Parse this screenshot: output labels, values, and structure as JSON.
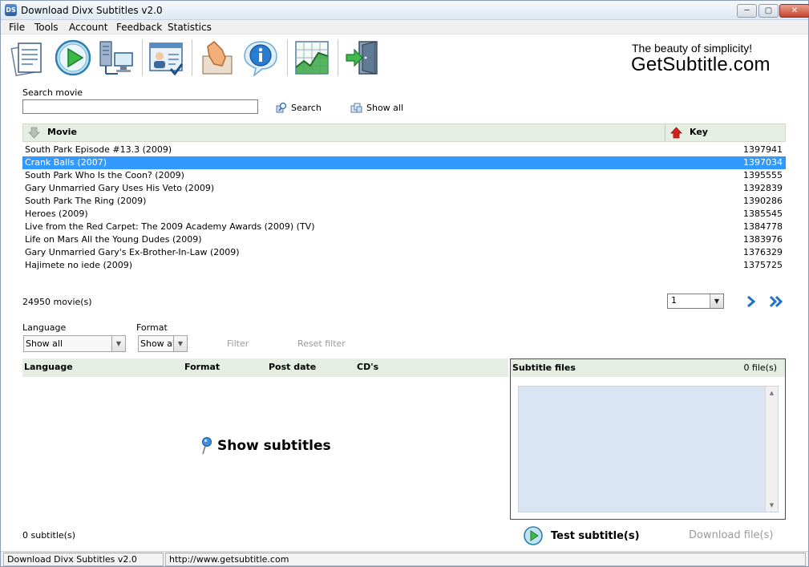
{
  "window": {
    "title": "Download Divx Subtitles v2.0",
    "app_icon_text": "DS",
    "minimize": "─",
    "maximize": "▢",
    "close": "✕"
  },
  "menu": {
    "items": [
      "File",
      "Tools",
      "Account",
      "Feedback",
      "Statistics"
    ]
  },
  "branding": {
    "tagline": "The beauty of simplicity!",
    "site": "GetSubtitle.com"
  },
  "search": {
    "label": "Search movie",
    "value": "",
    "search_label": "Search",
    "show_all_label": "Show all"
  },
  "movies": {
    "columns": {
      "movie": "Movie",
      "key": "Key"
    },
    "rows": [
      {
        "title": "South Park Episode #13.3 (2009)",
        "key": "1397941"
      },
      {
        "title": "Crank Balls (2007)",
        "key": "1397034"
      },
      {
        "title": "South Park Who Is the Coon? (2009)",
        "key": "1395555"
      },
      {
        "title": "Gary Unmarried Gary Uses His Veto (2009)",
        "key": "1392839"
      },
      {
        "title": "South Park The Ring (2009)",
        "key": "1390286"
      },
      {
        "title": "Heroes (2009)",
        "key": "1385545"
      },
      {
        "title": "Live from the Red Carpet: The 2009 Academy Awards (2009) (TV)",
        "key": "1384778"
      },
      {
        "title": "Life on Mars All the Young Dudes (2009)",
        "key": "1383976"
      },
      {
        "title": "Gary Unmarried Gary's Ex-Brother-In-Law (2009)",
        "key": "1376329"
      },
      {
        "title": "Hajimete no iede (2009)",
        "key": "1375725"
      }
    ],
    "selected_index": 1,
    "count_text": "24950 movie(s)"
  },
  "pagination": {
    "page": "1"
  },
  "filters": {
    "language_label": "Language",
    "language_value": "Show all",
    "format_label": "Format",
    "format_value": "Show all",
    "filter_label": "Filter",
    "reset_label": "Reset filter"
  },
  "subtitles": {
    "columns": {
      "language": "Language",
      "format": "Format",
      "post_date": "Post date",
      "cds": "CD's"
    },
    "show_label": "Show subtitles",
    "count_text": "0 subtitle(s)"
  },
  "files": {
    "title": "Subtitle files",
    "count": "0 file(s)"
  },
  "actions": {
    "test": "Test subtitle(s)",
    "download": "Download file(s)"
  },
  "status": {
    "app": "Download Divx Subtitles v2.0",
    "url": "http://www.getsubtitle.com"
  },
  "colors": {
    "selection": "#3399ff",
    "header_bg": "#e6ede3",
    "list_bg": "#d9e5f3",
    "disabled": "#9a9a9a"
  }
}
